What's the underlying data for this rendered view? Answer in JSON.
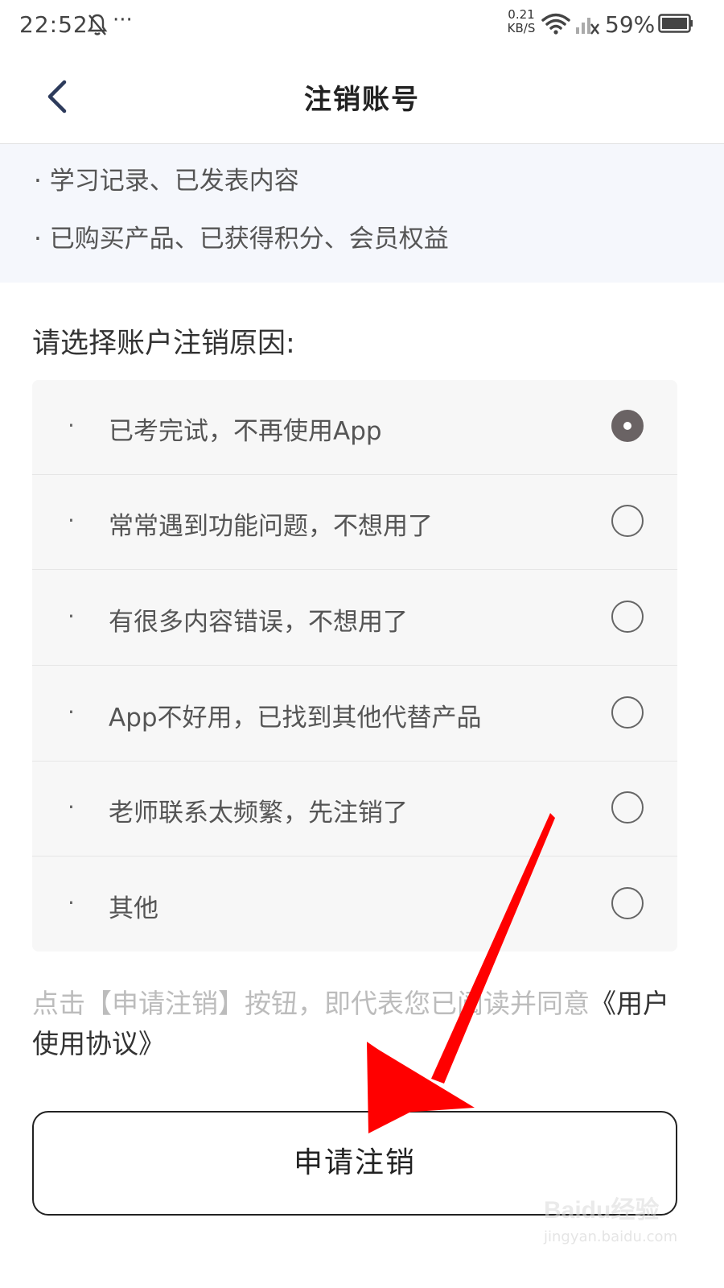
{
  "status_bar": {
    "time": "22:52",
    "more": "···",
    "net_speed_value": "0.21",
    "net_speed_unit": "KB/S",
    "battery_percent": "59%",
    "icons": [
      "bell-off-icon",
      "wifi-icon",
      "signal-icon",
      "battery-icon"
    ]
  },
  "nav": {
    "title": "注销账号",
    "back_icon": "chevron-left-icon"
  },
  "info": {
    "items": [
      "· 学习记录、已发表内容",
      "· 已购买产品、已获得积分、会员权益"
    ]
  },
  "reasons": {
    "heading": "请选择账户注销原因:",
    "bullet": "·",
    "selected_index": 0,
    "items": [
      {
        "label": "已考完试，不再使用App",
        "selected": true
      },
      {
        "label": "常常遇到功能问题，不想用了",
        "selected": false
      },
      {
        "label": "有很多内容错误，不想用了",
        "selected": false
      },
      {
        "label": "App不好用，已找到其他代替产品",
        "selected": false
      },
      {
        "label": "老师联系太频繁，先注销了",
        "selected": false
      },
      {
        "label": "其他",
        "selected": false
      }
    ]
  },
  "agreement": {
    "prefix": "点击【申请注销】按钮，即代表您已阅读并同意",
    "link": "《用户使用协议》"
  },
  "submit": {
    "label": "申请注销"
  },
  "watermark": {
    "brand": "Baidu经验",
    "url": "jingyan.baidu.com"
  },
  "colors": {
    "accent_arrow": "#ff0000",
    "radio_selected": "#6a6364",
    "info_bg": "#f5f7fc",
    "list_bg": "#f7f7f7"
  }
}
